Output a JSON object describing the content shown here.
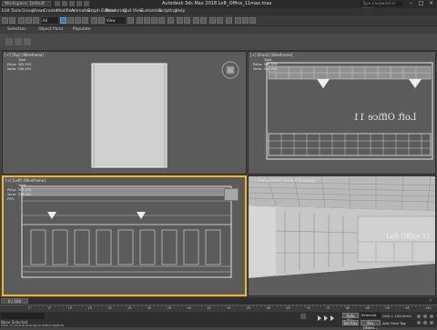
{
  "app": {
    "workspace": "Workspace: Default",
    "window_title": "Autodesk 3ds Max 2018     Loft_Office_11max.max",
    "search_placeholder": "Type a keyword or phrase"
  },
  "menu": [
    "Edit",
    "Tools",
    "Group",
    "Views",
    "Create",
    "Modifiers",
    "Animation",
    "Graph Editors",
    "Rendering",
    "Civil View",
    "Customize",
    "Scripting",
    "Help"
  ],
  "toolbar": {
    "view_select": "View"
  },
  "ribbon_tabs": [
    "Selection",
    "Object Paint",
    "Populate"
  ],
  "viewports": {
    "top": {
      "label": "[+] [Top] [Wireframe]",
      "stats": {
        "title": "Total",
        "polys_label": "Polys:",
        "polys": "305,970",
        "verts_label": "Verts:",
        "verts": "336,991"
      }
    },
    "front": {
      "label": "[+] [Front] [Wireframe]",
      "stats": {
        "title": "Total",
        "polys_label": "Polys:",
        "polys": "305,970",
        "verts_label": "Verts:",
        "verts": "336,991"
      },
      "sign": "Loft Office 11"
    },
    "left": {
      "label": "[+] [Left] [Wireframe]",
      "stats": {
        "title": "Total",
        "polys_label": "Polys:",
        "polys": "305,970",
        "verts_label": "Verts:",
        "verts": "336,991",
        "fps_label": "FPS:"
      }
    },
    "persp": {
      "label": "[+] [Perspective] [Default Shading]",
      "sign": "Loft Office 11"
    }
  },
  "timeline": {
    "frame": "0 / 100"
  },
  "trackbar_ticks": [
    "0",
    "5",
    "10",
    "15",
    "20",
    "25",
    "30",
    "35",
    "40",
    "45",
    "50",
    "55",
    "60",
    "65",
    "70",
    "75",
    "80",
    "85",
    "90",
    "95",
    "100"
  ],
  "status": {
    "selected": "None Selected",
    "prompt": "Click or click-and-drag to select objects",
    "grid": "Grid = 100,0mm",
    "add_time_tag": "Add Time Tag",
    "auto_key": "Auto Key",
    "set_key": "Set Key",
    "selected_dd": "Selected",
    "key_filters": "Key Filters..."
  },
  "colors": {
    "active_border": "#f1b52f",
    "viewport_bg": "#5b5b5b",
    "ui_dark": "#2f2f2f"
  }
}
